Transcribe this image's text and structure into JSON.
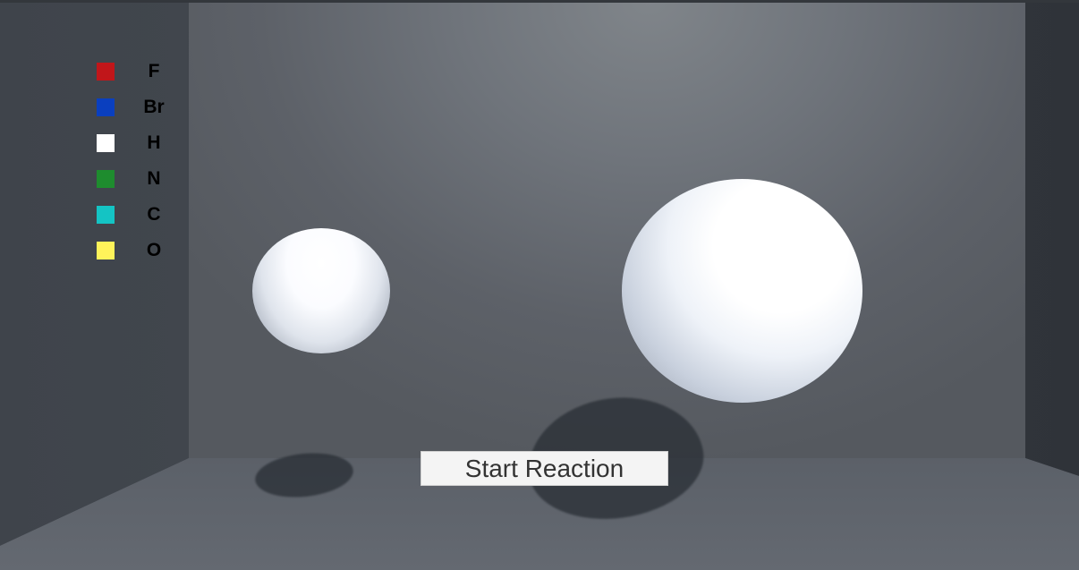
{
  "legend": {
    "items": [
      {
        "label": "F",
        "color": "#c1161a"
      },
      {
        "label": "Br",
        "color": "#0a3fbf"
      },
      {
        "label": "H",
        "color": "#ffffff"
      },
      {
        "label": "N",
        "color": "#1e8c2e"
      },
      {
        "label": "C",
        "color": "#14c4c4"
      },
      {
        "label": "O",
        "color": "#fff35a"
      }
    ]
  },
  "controls": {
    "start_label": "Start Reaction"
  },
  "scene": {
    "wall_color": "#6f747b",
    "floor_color": "#5b6068",
    "atom_color": "#ffffff"
  }
}
